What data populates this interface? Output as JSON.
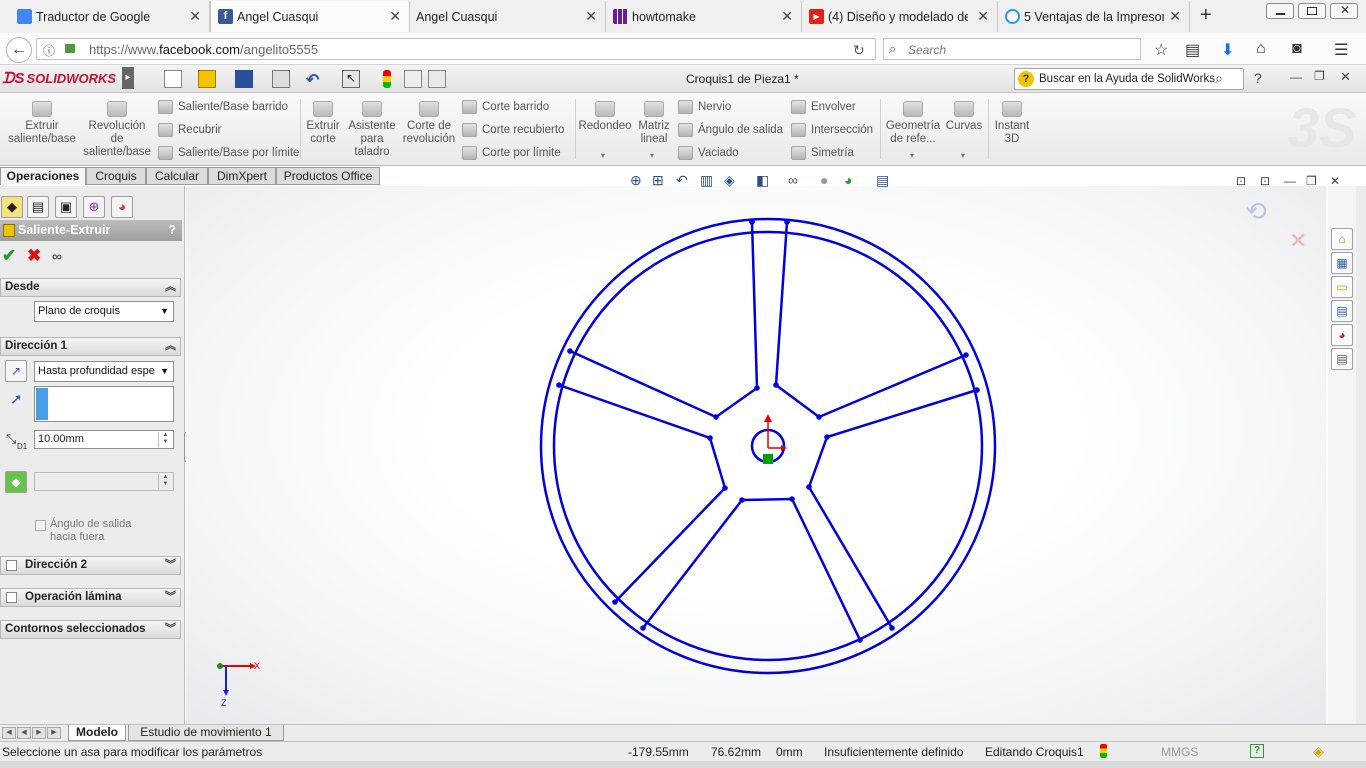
{
  "browser": {
    "tabs": [
      {
        "title": "Traductor de Google",
        "icon": "translate-icon",
        "color": "#4285f4"
      },
      {
        "title": "Angel Cuasqui",
        "icon": "facebook-icon",
        "color": "#3b5998",
        "active": true
      },
      {
        "title": "Angel Cuasqui",
        "icon": "",
        "color": ""
      },
      {
        "title": "howtomake",
        "icon": "grid-app-icon",
        "color": "#6a1b9a"
      },
      {
        "title": "(4) Diseño y modelado de",
        "icon": "youtube-icon",
        "color": "#e62117"
      },
      {
        "title": "5 Ventajas de la Impresora",
        "icon": "chat-bubble-icon",
        "color": "#2196f3"
      }
    ],
    "new_tab": "+",
    "url_prefix": "https://www.",
    "url_host": "facebook.com",
    "url_path": "/angelito5555",
    "search_placeholder": "Search"
  },
  "app": {
    "logo_text": "SOLIDWORKS",
    "document_title": "Croquis1 de Pieza1 *",
    "help_search_placeholder": "Buscar en la Ayuda de SolidWorks"
  },
  "ribbon": {
    "extrude_boss": "Extruir saliente/base",
    "revolve_boss": "Revolución de saliente/base",
    "swept_boss": "Saliente/Base barrido",
    "loft": "Recubrir",
    "boundary_boss": "Saliente/Base por límite",
    "extruded_cut": "Extruir corte",
    "hole_wizard": "Asistente para taladro",
    "revolved_cut": "Corte de revolución",
    "swept_cut": "Corte barrido",
    "lofted_cut": "Corte recubierto",
    "boundary_cut": "Corte por límite",
    "fillet": "Redondeo",
    "linear_pattern": "Matriz lineal",
    "rib": "Nervio",
    "draft": "Ángulo de salida",
    "shell": "Vaciado",
    "wrap": "Envolver",
    "intersect": "Intersección",
    "mirror": "Simetría",
    "ref_geometry": "Geometría de refe...",
    "curves": "Curvas",
    "instant3d": "Instant 3D"
  },
  "command_tabs": [
    "Operaciones",
    "Croquis",
    "Calcular",
    "DimXpert",
    "Productos Office"
  ],
  "property_manager": {
    "title": "Saliente-Extruir",
    "help": "?",
    "from_group": "Desde",
    "from_value": "Plano de croquis",
    "dir1_group": "Dirección 1",
    "end_condition": "Hasta profundidad espe",
    "depth": "10.00mm",
    "depth_label": "D1",
    "draft_label_1": "Ángulo de salida",
    "draft_label_2": "hacia fuera",
    "dir2_group": "Dirección 2",
    "thin_group": "Operación lámina",
    "contours_group": "Contornos seleccionados"
  },
  "triad": {
    "x_label": "X",
    "z_label": "Z"
  },
  "bottom_tabs": [
    "Modelo",
    "Estudio de movimiento 1"
  ],
  "status": {
    "message": "Seleccione un asa para modificar los parámetros",
    "x": "-179.55mm",
    "y": "76.62mm",
    "z": "0mm",
    "definition": "Insuficientemente definido",
    "editing": "Editando Croquis1",
    "units": "MMGS",
    "help": "?"
  },
  "colors": {
    "sketch_line": "#0000e0",
    "accent_red": "#c8102e",
    "origin_green": "#00a000"
  }
}
